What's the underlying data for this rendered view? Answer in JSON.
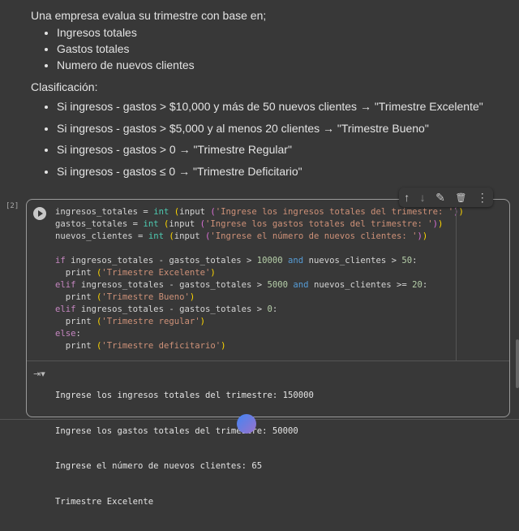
{
  "markdown": {
    "intro": "Una empresa evalua su trimestre con base en;",
    "inputs": [
      "Ingresos totales",
      "Gastos totales",
      "Numero de nuevos clientes"
    ],
    "classification_label": "Clasificación:",
    "rules": [
      "Si ingresos - gastos > $10,000 y más de 50 nuevos clientes → \"Trimestre Excelente\"",
      "Si ingresos - gastos > $5,000 y al menos 20 clientes → \"Trimestre Bueno\"",
      "Si ingresos - gastos > 0 → \"Trimestre Regular\"",
      "Si ingresos - gastos ≤ 0 → \"Trimestre Deficitario\""
    ]
  },
  "cell": {
    "execution_count": "[2]",
    "code_lines": [
      [
        [
          "",
          "ingresos_totales = "
        ],
        [
          "b",
          "int"
        ],
        [
          "p",
          " ("
        ],
        [
          "",
          "input "
        ],
        [
          "pk",
          "("
        ],
        [
          "s",
          "'Ingrese los ingresos totales del trimestre: '"
        ],
        [
          "pk",
          ")"
        ],
        [
          "p",
          ")"
        ]
      ],
      [
        [
          "",
          "gastos_totales = "
        ],
        [
          "b",
          "int"
        ],
        [
          "p",
          " ("
        ],
        [
          "",
          "input "
        ],
        [
          "pk",
          "("
        ],
        [
          "s",
          "'Ingrese los gastos totales del trimestre: '"
        ],
        [
          "pk",
          ")"
        ],
        [
          "p",
          ")"
        ]
      ],
      [
        [
          "",
          "nuevos_clientes = "
        ],
        [
          "b",
          "int"
        ],
        [
          "p",
          " ("
        ],
        [
          "",
          "input "
        ],
        [
          "pk",
          "("
        ],
        [
          "s",
          "'Ingrese el número de nuevos clientes: '"
        ],
        [
          "pk",
          ")"
        ],
        [
          "p",
          ")"
        ]
      ],
      [],
      [
        [
          "k",
          "if"
        ],
        [
          "",
          " ingresos_totales - gastos_totales > "
        ],
        [
          "n",
          "10000"
        ],
        [
          "",
          " "
        ],
        [
          "a",
          "and"
        ],
        [
          "",
          " nuevos_clientes > "
        ],
        [
          "n",
          "50"
        ],
        [
          "",
          ":"
        ]
      ],
      [
        [
          "",
          "  print "
        ],
        [
          "p",
          "("
        ],
        [
          "s",
          "'Trimestre Excelente'"
        ],
        [
          "p",
          ")"
        ]
      ],
      [
        [
          "k",
          "elif"
        ],
        [
          "",
          " ingresos_totales - gastos_totales > "
        ],
        [
          "n",
          "5000"
        ],
        [
          "",
          " "
        ],
        [
          "a",
          "and"
        ],
        [
          "",
          " nuevos_clientes >= "
        ],
        [
          "n",
          "20"
        ],
        [
          "",
          ":"
        ]
      ],
      [
        [
          "",
          "  print "
        ],
        [
          "p",
          "("
        ],
        [
          "s",
          "'Trimestre Bueno'"
        ],
        [
          "p",
          ")"
        ]
      ],
      [
        [
          "k",
          "elif"
        ],
        [
          "",
          " ingresos_totales - gastos_totales > "
        ],
        [
          "n",
          "0"
        ],
        [
          "",
          ":"
        ]
      ],
      [
        [
          "",
          "  print "
        ],
        [
          "p",
          "("
        ],
        [
          "s",
          "'Trimestre regular'"
        ],
        [
          "p",
          ")"
        ]
      ],
      [
        [
          "k",
          "else"
        ],
        [
          "",
          ":"
        ]
      ],
      [
        [
          "",
          "  print "
        ],
        [
          "p",
          "("
        ],
        [
          "s",
          "'Trimestre deficitario'"
        ],
        [
          "p",
          ")"
        ]
      ]
    ],
    "output_lines": [
      "Ingrese los ingresos totales del trimestre: 150000",
      "Ingrese los gastos totales del trimestre: 50000",
      "Ingrese el número de nuevos clientes: 65",
      "Trimestre Excelente"
    ]
  },
  "toolbar": {
    "move_up": "↑",
    "move_down": "↓",
    "edit": "✎",
    "delete": "🗑",
    "more": "⋮"
  }
}
